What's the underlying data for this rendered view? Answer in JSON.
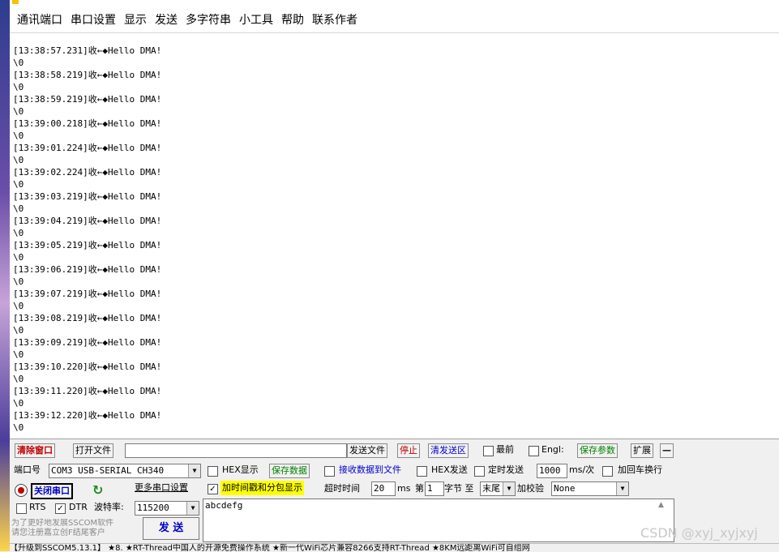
{
  "menu": [
    "通讯端口",
    "串口设置",
    "显示",
    "发送",
    "多字符串",
    "小工具",
    "帮助",
    "联系作者"
  ],
  "log_lines": [
    "[13:38:57.231]收←◆Hello DMA!",
    "\\0",
    "[13:38:58.219]收←◆Hello DMA!",
    "\\0",
    "[13:38:59.219]收←◆Hello DMA!",
    "\\0",
    "[13:39:00.218]收←◆Hello DMA!",
    "\\0",
    "[13:39:01.224]收←◆Hello DMA!",
    "\\0",
    "[13:39:02.224]收←◆Hello DMA!",
    "\\0",
    "[13:39:03.219]收←◆Hello DMA!",
    "\\0",
    "[13:39:04.219]收←◆Hello DMA!",
    "\\0",
    "[13:39:05.219]收←◆Hello DMA!",
    "\\0",
    "[13:39:06.219]收←◆Hello DMA!",
    "\\0",
    "[13:39:07.219]收←◆Hello DMA!",
    "\\0",
    "[13:39:08.219]收←◆Hello DMA!",
    "\\0",
    "[13:39:09.219]收←◆Hello DMA!",
    "\\0",
    "[13:39:10.220]收←◆Hello DMA!",
    "\\0",
    "[13:39:11.220]收←◆Hello DMA!",
    "\\0",
    "[13:39:12.220]收←◆Hello DMA!",
    "\\0"
  ],
  "row1": {
    "clear_window": "清除窗口",
    "open_file": "打开文件",
    "file_path": "",
    "send_file": "发送文件",
    "stop": "停止",
    "clear_send": "清发送区",
    "top_most": "最前",
    "english": "Engl:",
    "save_params": "保存参数",
    "expand": "扩展",
    "minus": "—"
  },
  "row2": {
    "port_label": "端口号",
    "port_value": "COM3 USB-SERIAL CH340",
    "hex_display": "HEX显示",
    "save_data": "保存数据",
    "recv_to_file": "接收数据到文件",
    "hex_send": "HEX发送",
    "timed_send": "定时发送",
    "interval": "1000",
    "interval_unit": "ms/次",
    "add_crlf": "加回车换行"
  },
  "row3": {
    "close_port": "关闭串口",
    "more_ports": "更多串口设置",
    "timestamp": "加时间戳和分包显示",
    "timeout_label": "超时时间",
    "timeout_value": "20",
    "ms": "ms",
    "nth_label": "第",
    "nth_value": "1",
    "byte_label": "字节 至",
    "end_value": "末尾",
    "checksum_label": "加校验",
    "checksum_value": "None"
  },
  "row4": {
    "rts": "RTS",
    "dtr": "DTR",
    "baud_label": "波特率:",
    "baud_value": "115200",
    "send_text": "abcdefg"
  },
  "promo": [
    "为了更好地发展SSCOM软件",
    "请您注册嘉立创F结尾客户"
  ],
  "send_button": "发 送",
  "status_bar": "【升级到SSCOM5.13.1】 ★8. ★RT-Thread中国人的开源免费操作系统 ★新一代WiFi芯片兼容8266支持RT-Thread ★8KM远距离WiFi可自组网",
  "watermark": "CSDN @xyj_xyjxyj"
}
